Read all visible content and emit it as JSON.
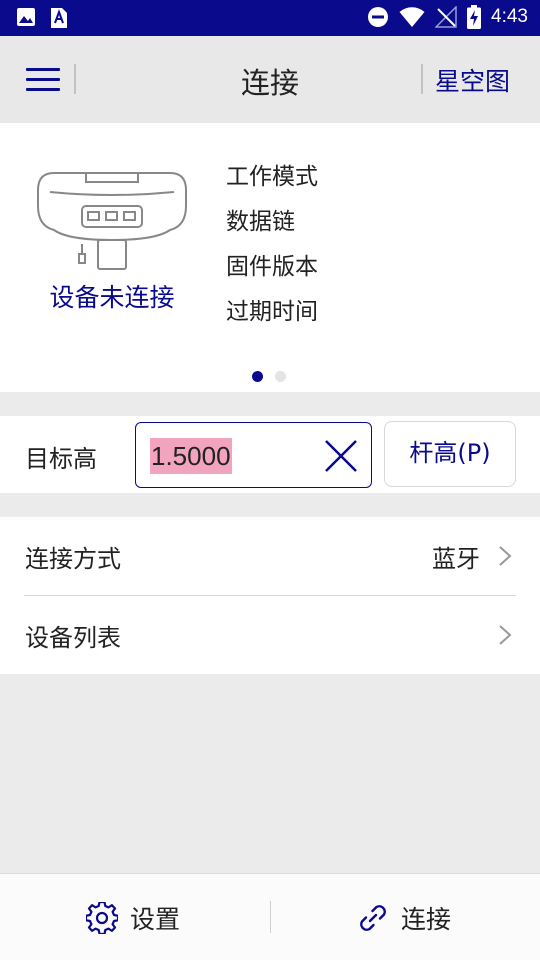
{
  "status_bar": {
    "time": "4:43",
    "icons": [
      "image-icon",
      "font-icon",
      "do-not-disturb-icon",
      "wifi-icon",
      "no-signal-icon",
      "battery-charging-icon"
    ]
  },
  "header": {
    "menu_icon": "menu-icon",
    "title": "连接",
    "right_action": "星空图"
  },
  "device": {
    "image_icon": "gnss-receiver-icon",
    "status": "设备未连接",
    "info_labels": [
      "工作模式",
      "数据链",
      "固件版本",
      "过期时间"
    ],
    "pager": {
      "pages": 2,
      "active": 0
    }
  },
  "target_height": {
    "label": "目标高",
    "value": "1.5000",
    "clear_icon": "close-icon",
    "pole_button": "杆高(P)"
  },
  "settings": [
    {
      "label": "连接方式",
      "value": "蓝牙",
      "chevron_icon": "chevron-right-icon"
    },
    {
      "label": "设备列表",
      "value": "",
      "chevron_icon": "chevron-right-icon"
    }
  ],
  "bottom_bar": {
    "settings_label": "设置",
    "settings_icon": "gear-icon",
    "connect_label": "连接",
    "connect_icon": "link-icon"
  },
  "colors": {
    "accent": "#0a0a8c",
    "selection": "#f2a4be"
  }
}
